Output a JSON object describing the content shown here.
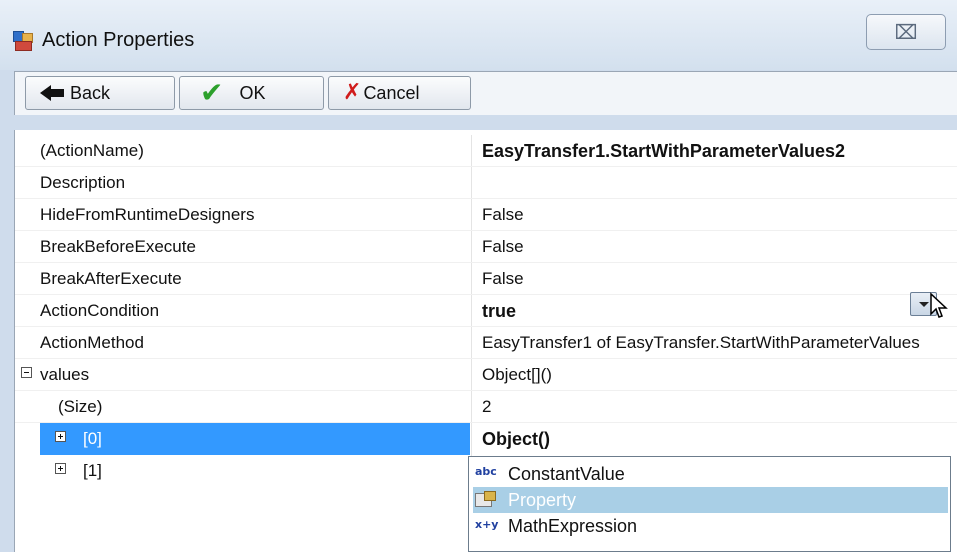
{
  "window": {
    "title": "Action Properties",
    "close_glyph": "⌧"
  },
  "toolbar": {
    "back_label": "Back",
    "ok_label": "OK",
    "cancel_label": "Cancel"
  },
  "properties": [
    {
      "name": "(ActionName)",
      "value": "EasyTransfer1.StartWithParameterValues2"
    },
    {
      "name": "Description",
      "value": ""
    },
    {
      "name": "HideFromRuntimeDesigners",
      "value": "False"
    },
    {
      "name": "BreakBeforeExecute",
      "value": "False"
    },
    {
      "name": "BreakAfterExecute",
      "value": "False"
    },
    {
      "name": "ActionCondition",
      "value": "true"
    },
    {
      "name": "ActionMethod",
      "value": "EasyTransfer1 of EasyTransfer.StartWithParameterValues"
    },
    {
      "name": "values",
      "value": "Object[]()"
    },
    {
      "name": "(Size)",
      "value": "2"
    },
    {
      "name": "[0]",
      "value": "Object()"
    },
    {
      "name": "[1]",
      "value": ""
    }
  ],
  "dropdown": {
    "items": [
      {
        "label": "ConstantValue",
        "icon": "abc"
      },
      {
        "label": "Property",
        "icon": "property-icon"
      },
      {
        "label": "MathExpression",
        "icon": "x+y"
      }
    ],
    "highlighted_index": 1
  },
  "icons": {
    "app": "app-icon",
    "back": "back-arrow-icon",
    "ok": "check-icon",
    "cancel": "x-icon"
  },
  "colors": {
    "selection": "#3399ff",
    "dropdown_highlight": "#a9cfe6",
    "check": "#2ca02c",
    "cancel_x": "#d01c1c"
  }
}
